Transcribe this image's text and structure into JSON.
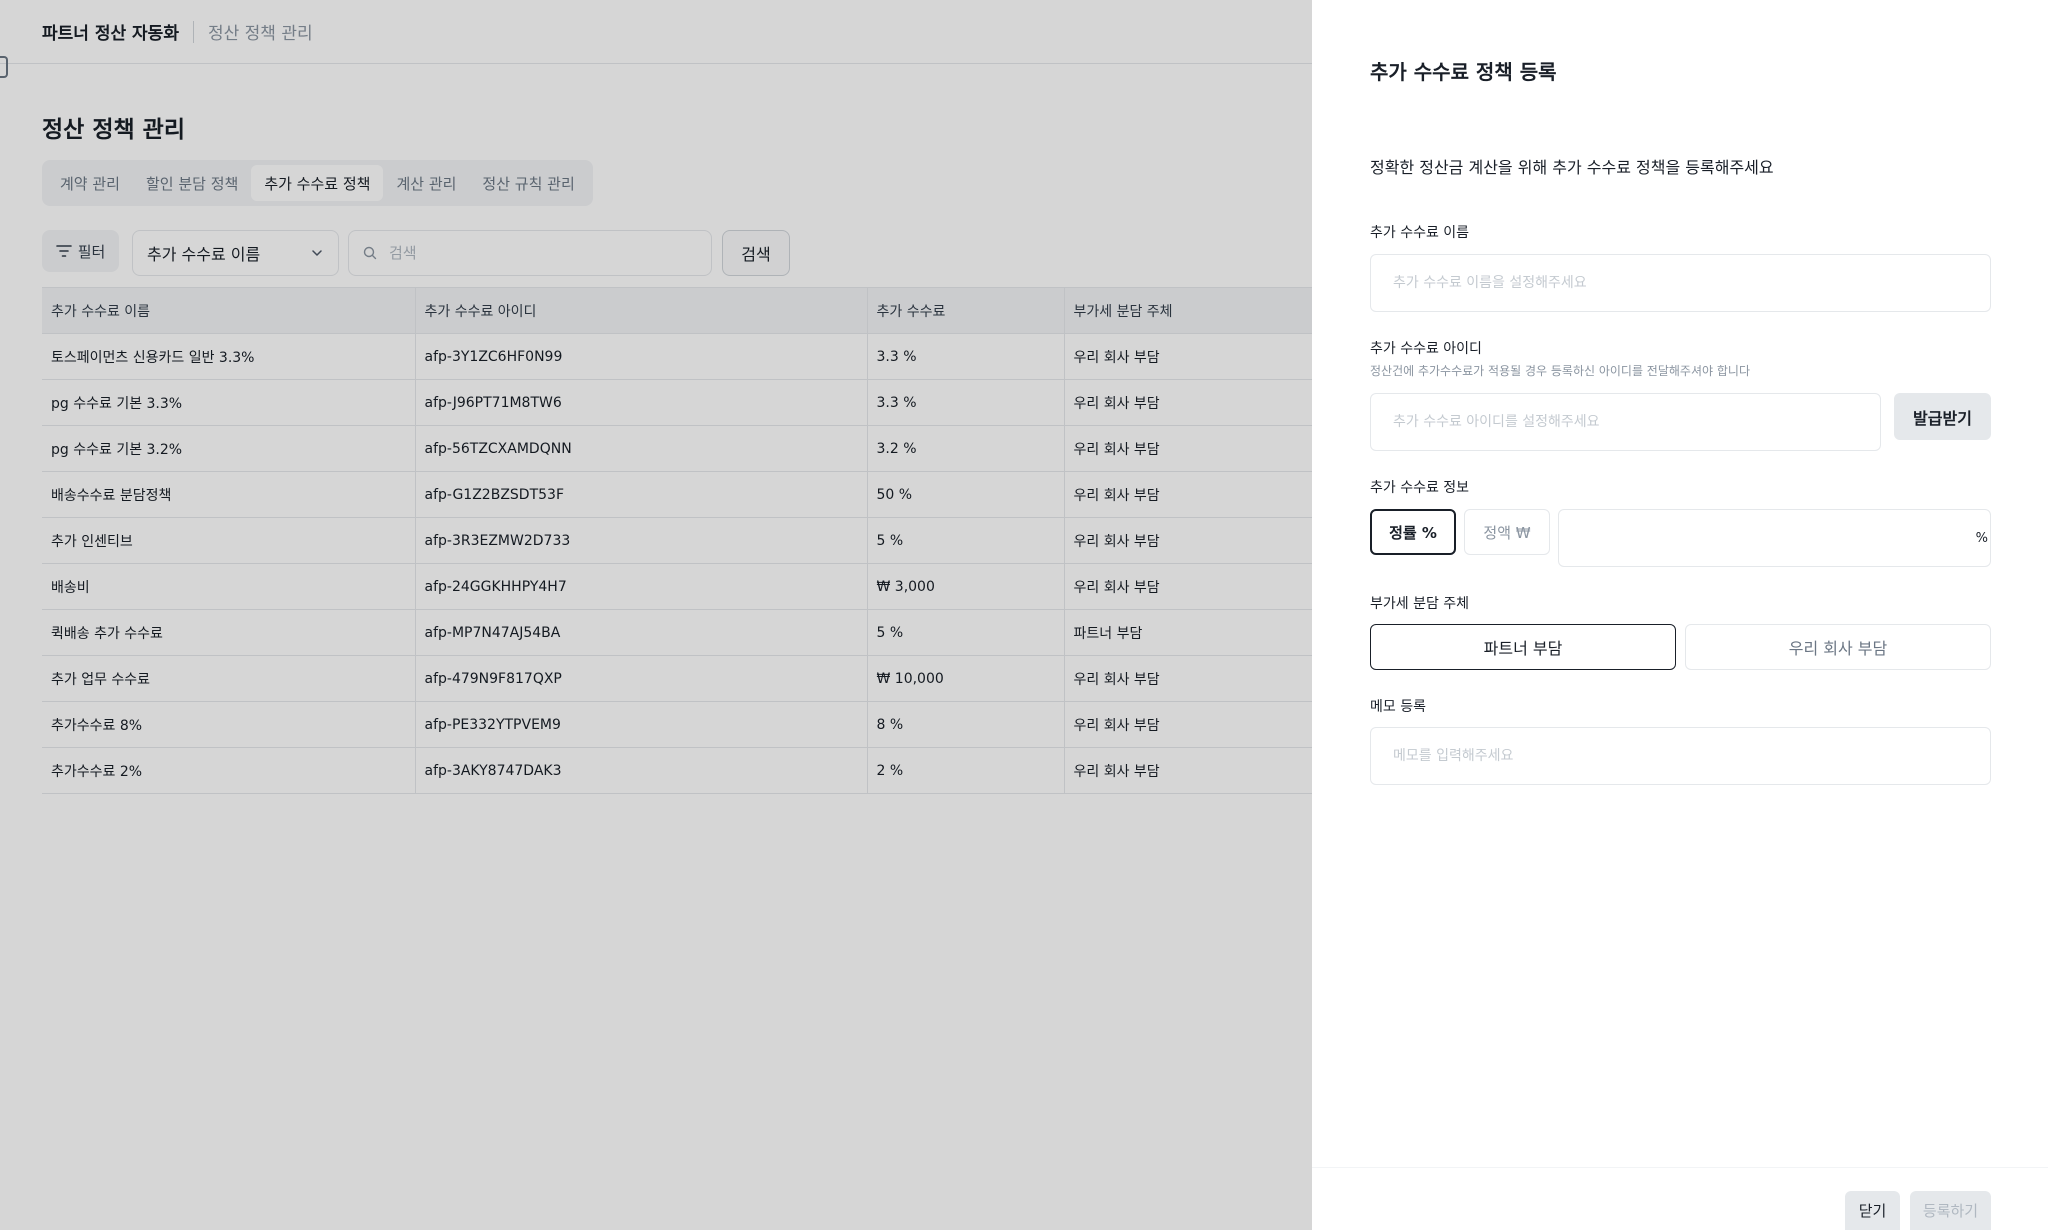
{
  "header": {
    "app_title": "파트너 정산 자동화",
    "breadcrumb": "정산 정책 관리"
  },
  "page": {
    "title": "정산 정책 관리",
    "tabs": [
      {
        "label": "계약 관리",
        "active": false
      },
      {
        "label": "할인 분담 정책",
        "active": false
      },
      {
        "label": "추가 수수료 정책",
        "active": true
      },
      {
        "label": "계산 관리",
        "active": false
      },
      {
        "label": "정산 규칙 관리",
        "active": false
      }
    ]
  },
  "toolbar": {
    "filter_label": "필터",
    "select_value": "추가 수수료 이름",
    "search_placeholder": "검색",
    "search_button": "검색"
  },
  "table": {
    "columns": [
      "추가 수수료 이름",
      "추가 수수료 아이디",
      "추가 수수료",
      "부가세 분담 주체"
    ],
    "rows": [
      [
        "토스페이먼츠 신용카드 일반 3.3%",
        "afp-3Y1ZC6HF0N99",
        "3.3 %",
        "우리 회사 부담"
      ],
      [
        "pg 수수료 기본 3.3%",
        "afp-J96PT71M8TW6",
        "3.3 %",
        "우리 회사 부담"
      ],
      [
        "pg 수수료 기본 3.2%",
        "afp-56TZCXAMDQNN",
        "3.2 %",
        "우리 회사 부담"
      ],
      [
        "배송수수료 분담정책",
        "afp-G1Z2BZSDT53F",
        "50 %",
        "우리 회사 부담"
      ],
      [
        "추가 인센티브",
        "afp-3R3EZMW2D733",
        "5 %",
        "우리 회사 부담"
      ],
      [
        "배송비",
        "afp-24GGKHHPY4H7",
        "₩ 3,000",
        "우리 회사 부담"
      ],
      [
        "퀵배송 추가 수수료",
        "afp-MP7N47AJ54BA",
        "5 %",
        "파트너 부담"
      ],
      [
        "추가 업무 수수료",
        "afp-479N9F817QXP",
        "₩ 10,000",
        "우리 회사 부담"
      ],
      [
        "추가수수료 8%",
        "afp-PE332YTPVEM9",
        "8 %",
        "우리 회사 부담"
      ],
      [
        "추가수수료 2%",
        "afp-3AKY8747DAK3",
        "2 %",
        "우리 회사 부담"
      ]
    ]
  },
  "drawer": {
    "title": "추가 수수료 정책 등록",
    "description": "정확한 정산금 계산을 위해 추가 수수료 정책을 등록해주세요",
    "name_label": "추가 수수료 이름",
    "name_placeholder": "추가 수수료 이름을 설정해주세요",
    "id_label": "추가 수수료 아이디",
    "id_help": "정산건에 추가수수료가 적용될 경우 등록하신 아이디를 전달해주셔야 합니다",
    "id_placeholder": "추가 수수료 아이디를 설정해주세요",
    "issue_button": "발급받기",
    "info_label": "추가 수수료 정보",
    "type_rate": "정률 %",
    "type_amount": "정액 ₩",
    "rate_unit": "%",
    "vat_label": "부가세 분담 주체",
    "vat_partner": "파트너 부담",
    "vat_company": "우리 회사 부담",
    "memo_label": "메모 등록",
    "memo_placeholder": "메모를 입력해주세요",
    "close_button": "닫기",
    "submit_button": "등록하기"
  }
}
